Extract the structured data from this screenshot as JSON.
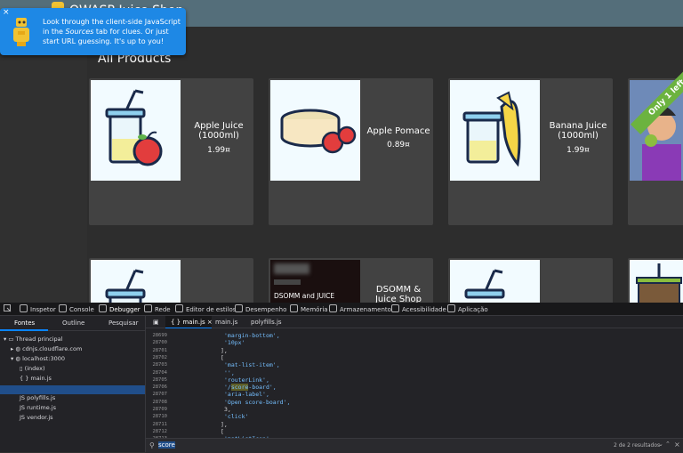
{
  "app": {
    "title": "OWASP Juice Shop",
    "heading": "All Products",
    "products": [
      {
        "name": "Apple Juice (1000ml)",
        "price": "1.99¤",
        "ribbon": ""
      },
      {
        "name": "Apple Pomace",
        "price": "0.89¤",
        "ribbon": ""
      },
      {
        "name": "Banana Juice (1000ml)",
        "price": "1.99¤",
        "ribbon": ""
      },
      {
        "name": "",
        "price": "",
        "ribbon": "Only 1 left"
      },
      {
        "name": "",
        "price": "",
        "ribbon": ""
      },
      {
        "name": "DSOMM & Juice Shop",
        "price": "",
        "ribbon": "",
        "thumb_caption": "DSOMM and JUICE"
      },
      {
        "name": "",
        "price": "",
        "ribbon": ""
      },
      {
        "name": "",
        "price": "",
        "ribbon": ""
      }
    ]
  },
  "toast": {
    "close": "×",
    "line1": "Look through the client-side JavaScript in the",
    "line2_em": "Sources",
    "line2_rest": " tab for clues. Or just start URL",
    "line3": "guessing. It's up to you!"
  },
  "devtools": {
    "tabs": [
      "Inspetor",
      "Console",
      "Debugger",
      "Rede",
      "Editor de estilos",
      "Desempenho",
      "Memória",
      "Armazenamento",
      "Acessibilidade",
      "Aplicação"
    ],
    "left_tabs": [
      "Fontes",
      "Outline",
      "Pesquisar"
    ],
    "tree": [
      "Thread principal",
      "cdnjs.cloudflare.com",
      "localhost:3000",
      "(index)",
      "main.js",
      "polyfills.js",
      "runtime.js",
      "vendor.js"
    ],
    "editor_tabs": [
      "main.js",
      "main.js",
      "polyfills.js"
    ],
    "lines": [
      {
        "n": "28699",
        "t": "'margin-bottom',"
      },
      {
        "n": "28700",
        "t": "'10px'"
      },
      {
        "n": "28701",
        "t": "],"
      },
      {
        "n": "28702",
        "t": "["
      },
      {
        "n": "28703",
        "t": "'mat-list-item',"
      },
      {
        "n": "28704",
        "t": "'',"
      },
      {
        "n": "28705",
        "t": "'routerLink',"
      },
      {
        "n": "28706",
        "t": "'/score-board',"
      },
      {
        "n": "28707",
        "t": "'aria-label',"
      },
      {
        "n": "28708",
        "t": "'Open score-board',"
      },
      {
        "n": "28709",
        "t": "3,"
      },
      {
        "n": "28710",
        "t": "'click'"
      },
      {
        "n": "28711",
        "t": "],"
      },
      {
        "n": "28712",
        "t": "["
      },
      {
        "n": "28713",
        "t": "'matListIcon',"
      }
    ],
    "search_value": "score",
    "search_result": "2 de 2 resultados"
  }
}
